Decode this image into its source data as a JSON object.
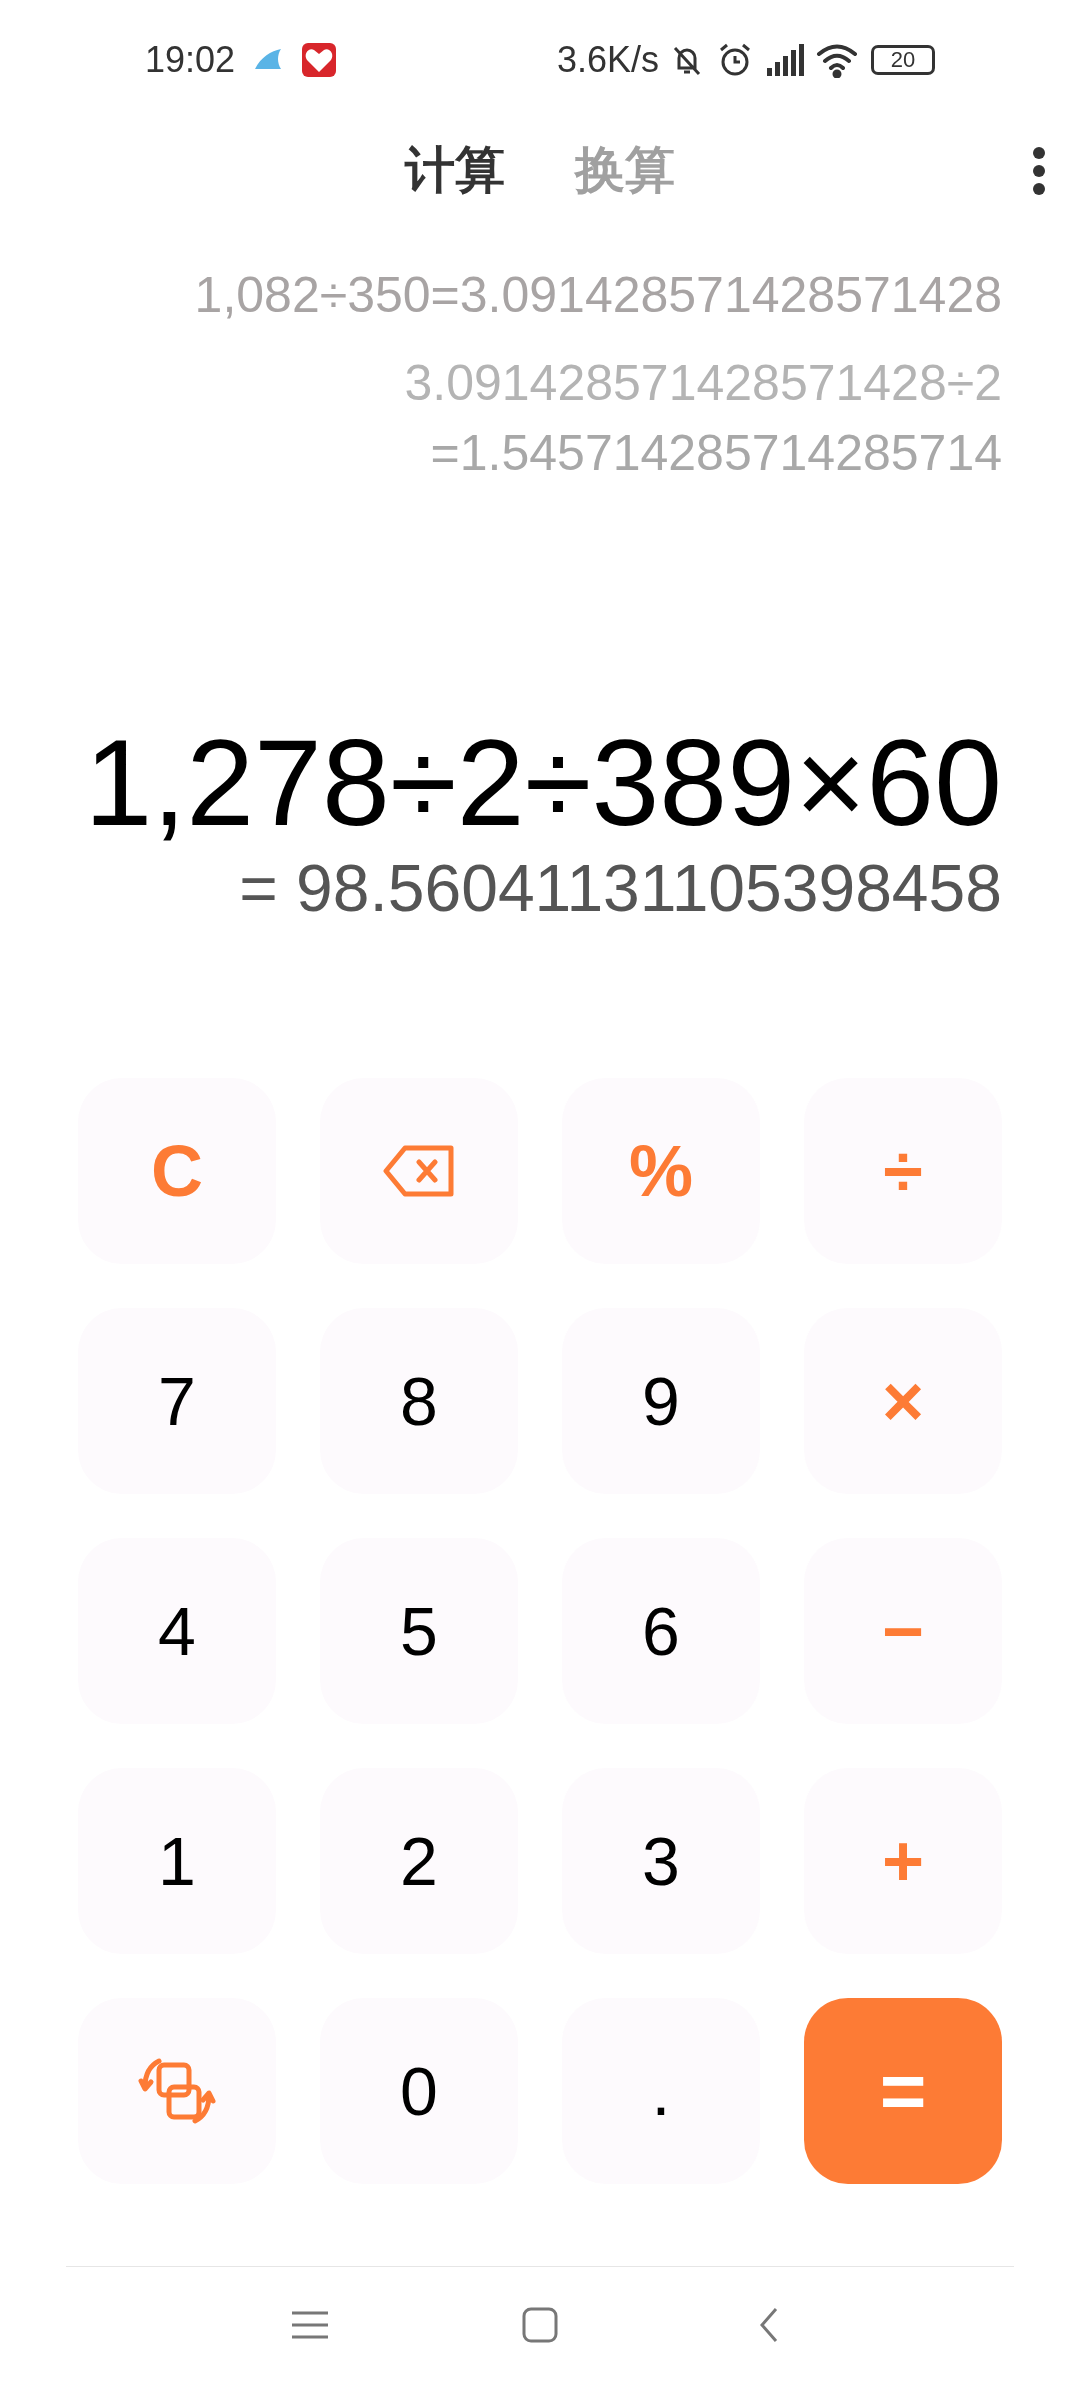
{
  "status_bar": {
    "time": "19:02",
    "network_speed": "3.6K/s",
    "battery": "20"
  },
  "tabs": [
    {
      "label": "计算",
      "selected": true
    },
    {
      "label": "换算",
      "selected": false
    }
  ],
  "history": [
    "1,082÷350=3.091428571428571428",
    "3.091428571428571428÷2",
    "=1.545714285714285714"
  ],
  "expression": "1,278÷2÷389×60",
  "result": "= 98.56041131105398458",
  "keys": [
    {
      "kind": "operator",
      "label": "C"
    },
    {
      "kind": "backspace"
    },
    {
      "kind": "operator",
      "label": "%"
    },
    {
      "kind": "operator",
      "label": "÷"
    },
    {
      "kind": "digit",
      "label": "7"
    },
    {
      "kind": "digit",
      "label": "8"
    },
    {
      "kind": "digit",
      "label": "9"
    },
    {
      "kind": "operator",
      "label": "×"
    },
    {
      "kind": "digit",
      "label": "4"
    },
    {
      "kind": "digit",
      "label": "5"
    },
    {
      "kind": "digit",
      "label": "6"
    },
    {
      "kind": "operator",
      "label": "−"
    },
    {
      "kind": "digit",
      "label": "1"
    },
    {
      "kind": "digit",
      "label": "2"
    },
    {
      "kind": "digit",
      "label": "3"
    },
    {
      "kind": "operator",
      "label": "+"
    },
    {
      "kind": "convert"
    },
    {
      "kind": "digit",
      "label": "0"
    },
    {
      "kind": "digit",
      "label": "."
    },
    {
      "kind": "equals",
      "label": "="
    }
  ]
}
